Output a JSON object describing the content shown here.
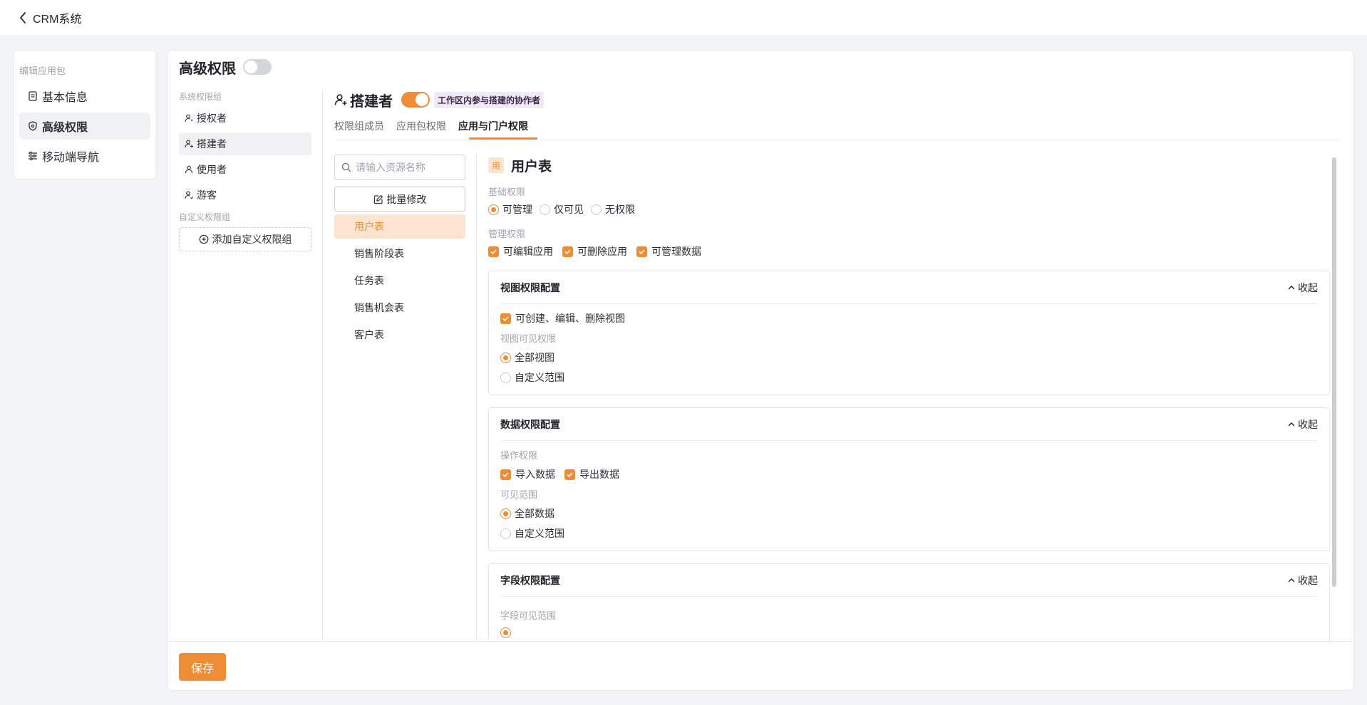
{
  "app": {
    "title": "CRM系统"
  },
  "nav": {
    "group_label": "编辑应用包",
    "items": [
      {
        "label": "基本信息",
        "icon": "document-icon"
      },
      {
        "label": "高级权限",
        "icon": "shield-icon",
        "active": true
      },
      {
        "label": "移动端导航",
        "icon": "sliders-icon"
      }
    ]
  },
  "main": {
    "title": "高级权限",
    "advanced_toggle": "off"
  },
  "roles": {
    "system_group_label": "系统权限组",
    "items": [
      {
        "label": "授权者"
      },
      {
        "label": "搭建者",
        "active": true
      },
      {
        "label": "使用者"
      },
      {
        "label": "游客"
      }
    ],
    "custom_group_label": "自定义权限组",
    "add_custom_label": "添加自定义权限组"
  },
  "role_panel": {
    "name": "搭建者",
    "toggle": "on",
    "description": "工作区内参与搭建的协作者",
    "tabs": [
      "权限组成员",
      "应用包权限",
      "应用与门户权限"
    ],
    "active_tab": "应用与门户权限"
  },
  "resources": {
    "search_placeholder": "请输入资源名称",
    "batch_label": "批量修改",
    "items": [
      "用户表",
      "销售阶段表",
      "任务表",
      "销售机会表",
      "客户表"
    ],
    "active": "用户表"
  },
  "detail": {
    "icon_char": "用",
    "title": "用户表",
    "basic_label": "基础权限",
    "basic_options": [
      "可管理",
      "仅可见",
      "无权限"
    ],
    "basic_selected": "可管理",
    "manage_label": "管理权限",
    "manage_options": [
      "可编辑应用",
      "可删除应用",
      "可管理数据"
    ],
    "view_card": {
      "title": "视图权限配置",
      "collapse": "收起",
      "check_label": "可创建、编辑、删除视图",
      "visible_label": "视图可见权限",
      "options": [
        "全部视图",
        "自定义范围"
      ],
      "selected": "全部视图"
    },
    "data_card": {
      "title": "数据权限配置",
      "collapse": "收起",
      "op_label": "操作权限",
      "op_options": [
        "导入数据",
        "导出数据"
      ],
      "scope_label": "可见范围",
      "scope_options": [
        "全部数据",
        "自定义范围"
      ],
      "scope_selected": "全部数据"
    },
    "field_card": {
      "title": "字段权限配置",
      "collapse": "收起",
      "scope_label": "字段可见范围"
    }
  },
  "footer": {
    "save_label": "保存"
  },
  "colors": {
    "accent": "#ef8c36",
    "accent_light": "#fde4d0",
    "tag_bg": "#f2e8f7"
  }
}
